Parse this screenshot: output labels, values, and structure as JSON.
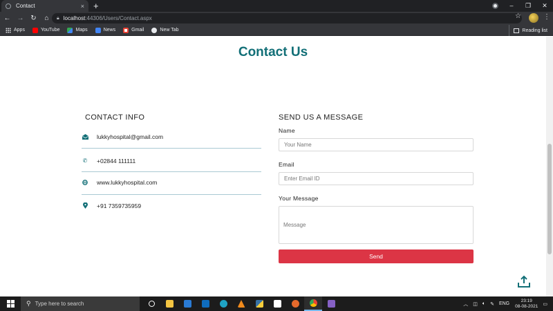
{
  "browser": {
    "tab_title": "Contact",
    "tab_close": "×",
    "new_tab": "+",
    "url_host": "localhost",
    "url_path": ":44306/Users/Contact.aspx",
    "bookmarks": [
      "Apps",
      "YouTube",
      "Maps",
      "News",
      "Gmail",
      "New Tab"
    ],
    "reading_list": "Reading list"
  },
  "page": {
    "title": "Contact Us",
    "contact_info": {
      "heading": "CONTACT INFO",
      "email": "lukkyhospital@gmail.com",
      "phone": "+02844 111111",
      "website": "www.lukkyhospital.com",
      "mobile": "+91 7359735959"
    },
    "message_form": {
      "heading": "SEND US A MESSAGE",
      "name_label": "Name",
      "name_placeholder": "Your Name",
      "email_label": "Email",
      "email_placeholder": "Enter Email ID",
      "message_label": "Your Message",
      "message_placeholder": "Message",
      "send_label": "Send"
    }
  },
  "taskbar": {
    "search_placeholder": "Type here to search",
    "language": "ENG",
    "time": "23:19",
    "date": "08-08-2021"
  },
  "colors": {
    "accent_teal": "#126f77",
    "send_red": "#dc3545",
    "divider_blue": "#a9c9d3"
  }
}
